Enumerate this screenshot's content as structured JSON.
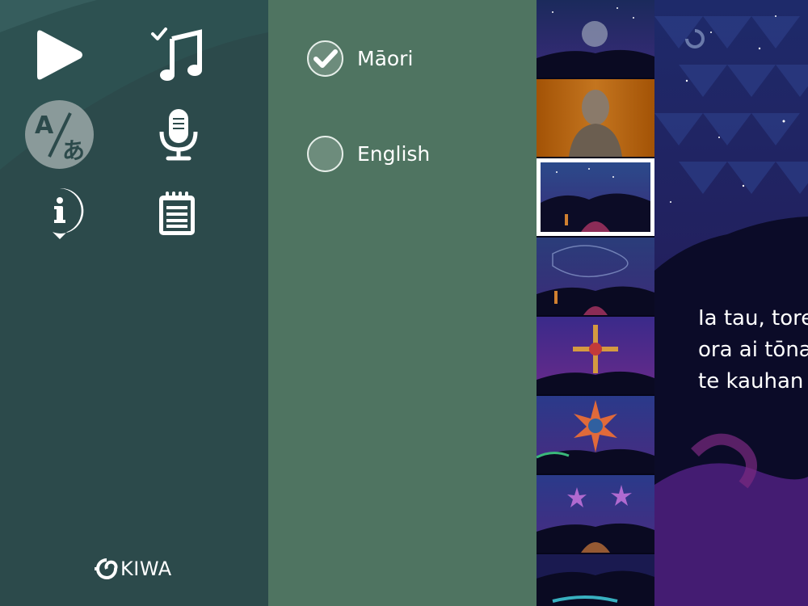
{
  "menu": {
    "buttons": [
      {
        "name": "play-icon"
      },
      {
        "name": "music-check-icon"
      },
      {
        "name": "translate-icon",
        "active": true
      },
      {
        "name": "microphone-icon"
      },
      {
        "name": "info-icon"
      },
      {
        "name": "notepad-icon"
      }
    ],
    "logo_text": "KIWA"
  },
  "language": {
    "options": [
      {
        "label": "Māori",
        "selected": true
      },
      {
        "label": "English",
        "selected": false
      }
    ]
  },
  "thumbnails": {
    "count": 8,
    "selected_index": 2
  },
  "lyrics": {
    "lines": [
      "Ia tau, tore",
      "ora ai tōna",
      "te kauhan"
    ]
  },
  "colors": {
    "menu_bg": "#2c4a4b",
    "language_bg": "#4f7461",
    "active_button_bg": "#8a9a9a"
  }
}
